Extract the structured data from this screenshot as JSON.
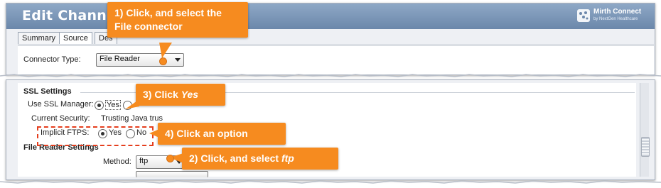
{
  "window": {
    "title": "Edit Channel",
    "logo_name": "Mirth Connect",
    "logo_sub": "by NextGen Healthcare"
  },
  "tabs": [
    {
      "label": "Summary"
    },
    {
      "label": "Source"
    },
    {
      "label": "Des"
    }
  ],
  "connector": {
    "type_label": "Connector Type:",
    "type_value": "File Reader"
  },
  "ssl": {
    "section_title": "SSL Settings",
    "use_ssl_label": "Use SSL Manager:",
    "use_ssl_yes": "Yes",
    "current_security_label": "Current Security:",
    "current_security_value": "Trusting Java trus",
    "implicit_ftps_label": "Implicit FTPS:",
    "implicit_ftps_yes": "Yes",
    "implicit_ftps_no": "No",
    "use_ssl_selected": "Yes",
    "implicit_ftps_selected": "Yes"
  },
  "file_reader": {
    "section_title": "File Reader Settings",
    "method_label": "Method:",
    "method_value": "ftp"
  },
  "callouts": {
    "step1": "1) Click, and select the File connector",
    "step2_prefix": "2) Click, and select ",
    "step2_em": "ftp",
    "step3_prefix": "3) Click ",
    "step3_em": "Yes",
    "step4": "4) Click an option"
  },
  "colors": {
    "callout": "#f68b1f",
    "highlight": "#e53e1d",
    "titlebar": "#7b96b8"
  }
}
